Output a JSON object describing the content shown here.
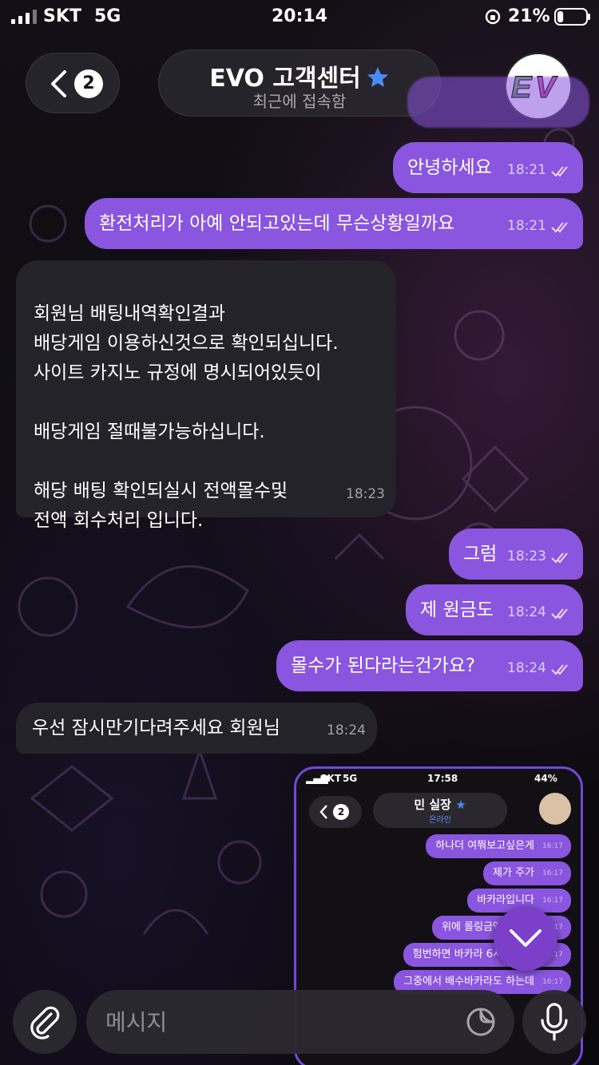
{
  "status_bar": {
    "carrier": "SKT",
    "network": "5G",
    "time": "20:14",
    "battery_pct": "21%",
    "battery_level": 0.21
  },
  "header": {
    "back_count": "2",
    "title": "EVO 고객센터",
    "subtitle": "최근에 접속함",
    "verified_icon": "star-badge-icon",
    "avatar_text": "EV"
  },
  "messages": [
    {
      "dir": "out",
      "text": "안녕하세요",
      "time": "18:21"
    },
    {
      "dir": "out",
      "text": "환전처리가 아예 안되고있는데 무슨상황일까요",
      "time": "18:21"
    },
    {
      "dir": "in",
      "text": "회원님 배팅내역확인결과\n배당게임 이용하신것으로 확인되십니다.\n사이트 카지노 규정에 명시되어있듯이\n\n배당게임 절때불가능하십니다.\n\n해당 배팅 확인되실시 전액몰수및\n전액 회수처리 입니다.",
      "time": "18:23"
    },
    {
      "dir": "out",
      "text": "그럼",
      "time": "18:23"
    },
    {
      "dir": "out",
      "text": "제 원금도",
      "time": "18:24"
    },
    {
      "dir": "out",
      "text": "몰수가 된다라는건가요?",
      "time": "18:24"
    },
    {
      "dir": "in",
      "text": "우선 잠시만기다려주세요 회원님",
      "time": "18:24"
    }
  ],
  "preview": {
    "carrier": "SKT",
    "network": "5G",
    "time": "17:58",
    "battery_pct": "44%",
    "back_count": "2",
    "title": "민 실장",
    "subtitle": "온라인",
    "messages": [
      {
        "text": "하나더 여쭤보고싶은게",
        "time": "16:17"
      },
      {
        "text": "제가 주가",
        "time": "16:17"
      },
      {
        "text": "바카라입니다",
        "time": "16:17"
      },
      {
        "text": "위에 롤링금액 보셔서",
        "time": "16:17"
      },
      {
        "text": "험번하면 바카라 6시간씩 돌",
        "time": "16:17"
      },
      {
        "text": "그중에서 배수바카라도 하는데",
        "time": "16:17"
      }
    ]
  },
  "composer": {
    "placeholder": "메시지"
  },
  "colors": {
    "outgoing_bubble": "#8a55df",
    "incoming_bubble": "#25232a",
    "accent": "#7b3fc9"
  }
}
